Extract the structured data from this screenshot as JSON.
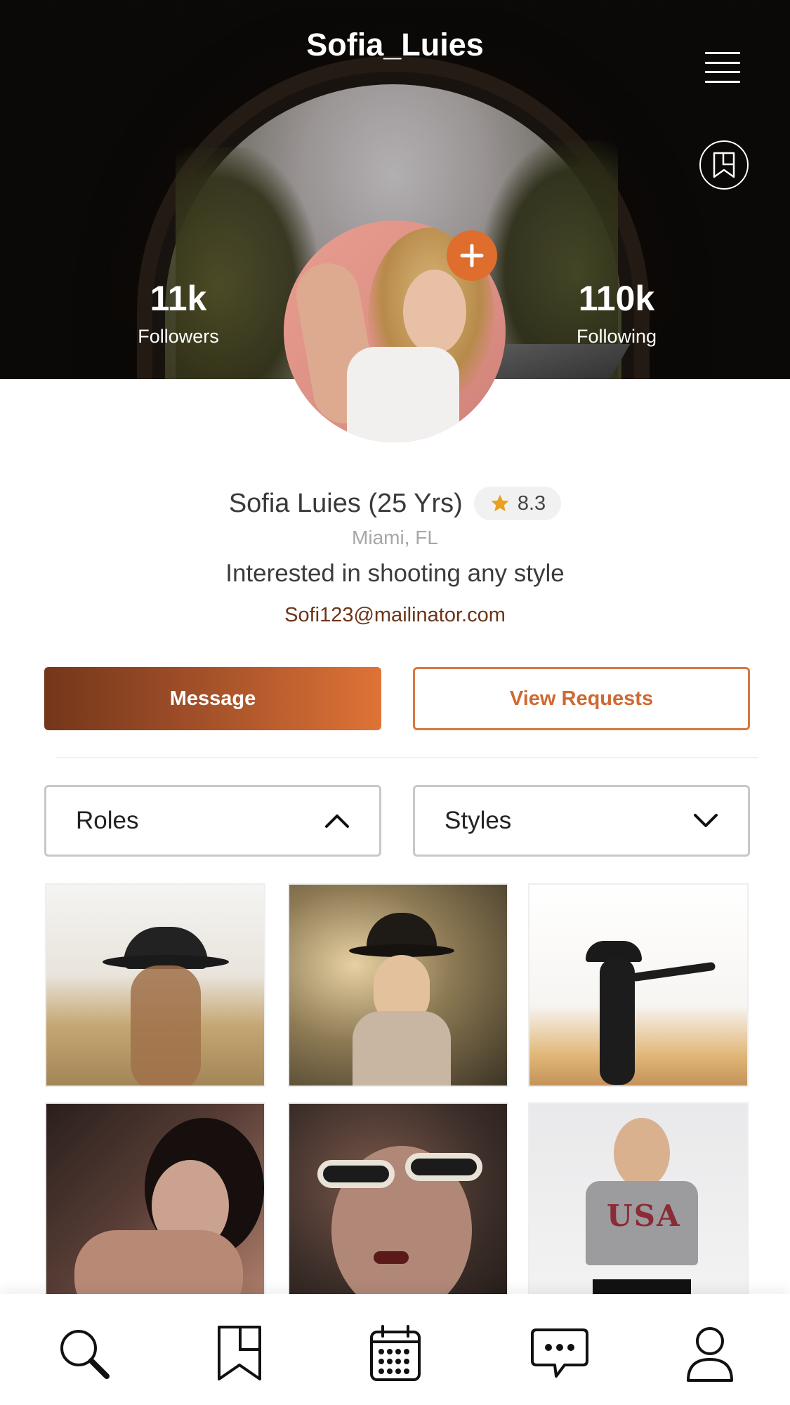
{
  "header": {
    "title": "Sofia_Luies",
    "menu_icon": "hamburger-menu-icon",
    "bookmark_icon": "bookmark-flag-icon"
  },
  "stats": {
    "followers": {
      "value": "11k",
      "label": "Followers"
    },
    "following": {
      "value": "110k",
      "label": "Following"
    }
  },
  "profile": {
    "name": "Sofia Luies (25 Yrs)",
    "rating": "8.3",
    "location": "Miami, FL",
    "bio": "Interested in shooting any style",
    "email": "Sofi123@mailinator.com"
  },
  "actions": {
    "message_label": "Message",
    "requests_label": "View Requests"
  },
  "filters": {
    "roles_label": "Roles",
    "roles_state": "expanded",
    "styles_label": "Styles",
    "styles_state": "collapsed"
  },
  "gallery": {
    "count_visible": 6
  },
  "tabbar": {
    "items": [
      "search-icon",
      "bookmark-icon",
      "calendar-icon",
      "chat-icon",
      "profile-icon"
    ]
  },
  "colors": {
    "accent": "#de6d2e",
    "gradient_start": "#74361a",
    "gradient_end": "#df7336",
    "email_color": "#6b3519"
  }
}
